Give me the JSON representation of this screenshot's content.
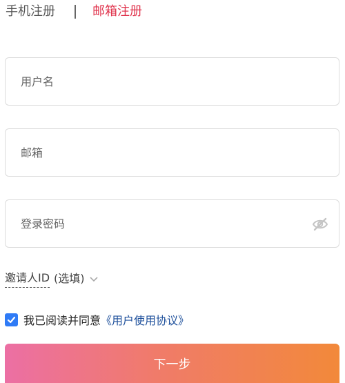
{
  "tabs": {
    "phone": "手机注册",
    "email": "邮箱注册"
  },
  "form": {
    "username_placeholder": "用户名",
    "email_placeholder": "邮箱",
    "password_placeholder": "登录密码",
    "password_icon": "eye-slash-icon"
  },
  "invite": {
    "label": "邀请人ID",
    "suffix": "(选填)",
    "icon": "chevron-down-icon"
  },
  "agreement": {
    "checked": true,
    "text": "我已阅读并同意",
    "link": "《用户使用协议》"
  },
  "actions": {
    "next_label": "下一步"
  },
  "colors": {
    "active_tab": "#e0344d",
    "checkbox": "#2f7bf6",
    "link": "#1d4f9b",
    "button_gradient_start": "#ec6fa4",
    "button_gradient_end": "#f2893a"
  }
}
